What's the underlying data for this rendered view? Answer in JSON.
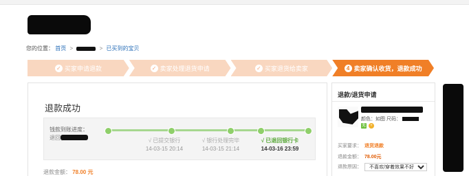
{
  "breadcrumb": {
    "prefix": "您的位置：",
    "home": "首页",
    "separator": ">",
    "current": "已买到的宝贝"
  },
  "steps": [
    {
      "label": "买家申请退款",
      "icon": "check-icon",
      "state": "done"
    },
    {
      "label": "卖家处理退货申请",
      "icon": "check-icon",
      "state": "done"
    },
    {
      "label": "买家退货给卖家",
      "icon": "check-icon",
      "state": "done"
    },
    {
      "label": "卖家确认收货，退款成功",
      "number": "4",
      "state": "active"
    }
  ],
  "main": {
    "title": "退款成功",
    "progress": {
      "label": "钱款到账进度：",
      "sub_prefix": "退回(",
      "stages": [
        {
          "label": "√ 已提交银行",
          "time": "14-03-15 20:14"
        },
        {
          "label": "√ 银行处理完毕",
          "time": "14-03-15 21:14"
        },
        {
          "label": "√ 已退回银行卡",
          "time": "14-03-16 23:59"
        }
      ]
    },
    "refund": {
      "label": "退款金额：",
      "value": "78.00 元"
    }
  },
  "side": {
    "title": "退款/退货申请",
    "product": {
      "attr_label": "颜色：如图 尺码：",
      "badges": [
        {
          "text": "无",
          "color": "#6bbf3a"
        },
        {
          "text": "+",
          "color": "#f1b12c"
        }
      ]
    },
    "rows": [
      {
        "label": "买家要求：",
        "value": "退货退款",
        "style": "orange"
      },
      {
        "label": "退款金额：",
        "value": "78.00元",
        "style": "red"
      },
      {
        "label": "退款原因：",
        "value": "不喜欢/穿着效果不好",
        "style": "select"
      }
    ]
  },
  "colors": {
    "accent": "#f07f27",
    "step_inactive": "#f9d7c0",
    "progress": "#8fcf6a",
    "link": "#2a6fb8"
  }
}
